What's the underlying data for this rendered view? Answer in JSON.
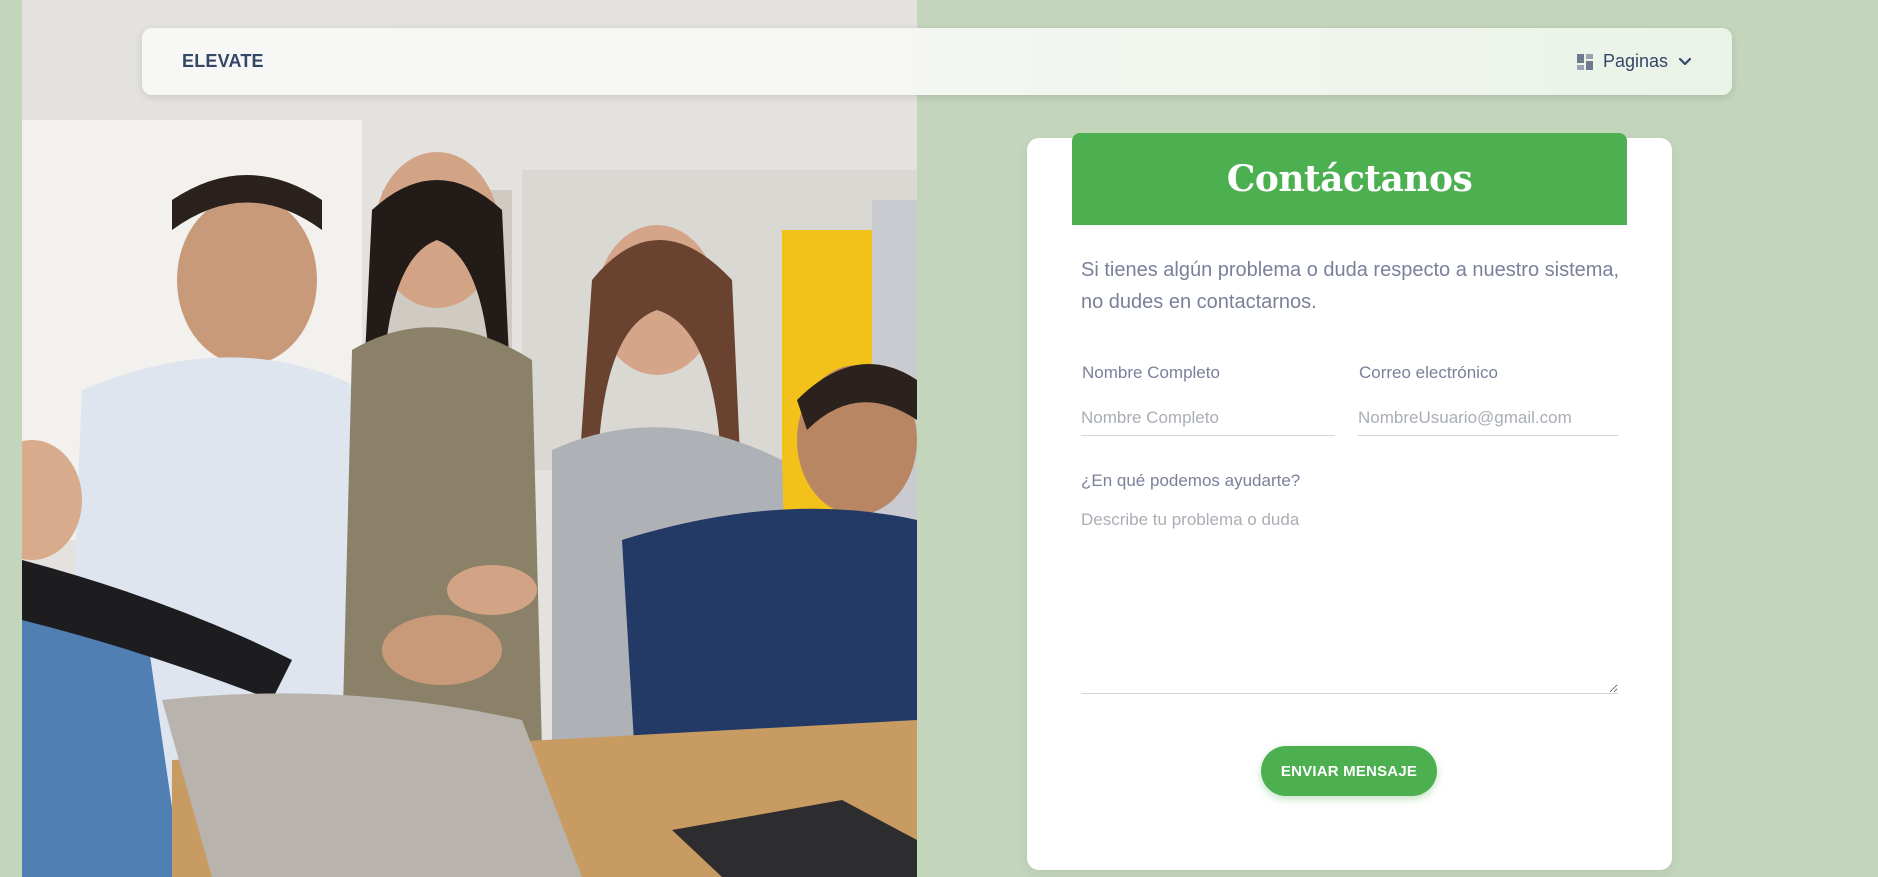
{
  "navbar": {
    "brand": "ELEVATE",
    "pages_menu": {
      "label": "Paginas",
      "icon": "dashboard-icon",
      "caret_icon": "chevron-down-icon"
    }
  },
  "photo": {
    "description_icon": "team-photo"
  },
  "contact": {
    "title": "Contáctanos",
    "description": "Si tienes algún problema o duda respecto a nuestro sistema, no dudes en contactarnos.",
    "name_field": {
      "label": "Nombre Completo",
      "placeholder": "Nombre Completo",
      "value": ""
    },
    "email_field": {
      "label": "Correo electrónico",
      "placeholder": "NombreUsuario@gmail.com",
      "value": ""
    },
    "message_field": {
      "label": "¿En qué podemos ayudarte?",
      "placeholder": "Describe tu problema o duda",
      "value": ""
    },
    "submit_label": "ENVIAR MENSAJE"
  },
  "colors": {
    "page_background": "#c3d5bb",
    "accent_green": "#4caf50",
    "text_dark": "#344767",
    "text_muted": "#7b809a"
  }
}
